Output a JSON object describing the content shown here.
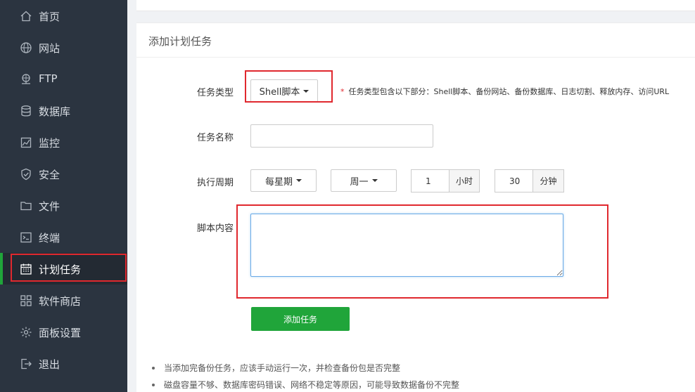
{
  "sidebar": {
    "items": [
      {
        "label": "首页",
        "icon": "home-icon"
      },
      {
        "label": "网站",
        "icon": "globe-icon"
      },
      {
        "label": "FTP",
        "icon": "ftp-icon"
      },
      {
        "label": "数据库",
        "icon": "database-icon"
      },
      {
        "label": "监控",
        "icon": "monitor-icon"
      },
      {
        "label": "安全",
        "icon": "shield-icon"
      },
      {
        "label": "文件",
        "icon": "folder-icon"
      },
      {
        "label": "终端",
        "icon": "terminal-icon"
      },
      {
        "label": "计划任务",
        "icon": "calendar-icon"
      },
      {
        "label": "软件商店",
        "icon": "apps-icon"
      },
      {
        "label": "面板设置",
        "icon": "gear-icon"
      },
      {
        "label": "退出",
        "icon": "logout-icon"
      }
    ],
    "active": "计划任务"
  },
  "form": {
    "title": "添加计划任务",
    "task_type_label": "任务类型",
    "task_type_value": "Shell脚本",
    "task_type_hint": "任务类型包含以下部分：Shell脚本、备份网站、备份数据库、日志切割、释放内存、访问URL",
    "task_name_label": "任务名称",
    "task_name_value": "",
    "cycle_label": "执行周期",
    "cycle_value": "每星期",
    "weekday_value": "周一",
    "hour_value": "1",
    "hour_unit": "小时",
    "minute_value": "30",
    "minute_unit": "分钟",
    "script_label": "脚本内容",
    "script_value": "",
    "submit_label": "添加任务"
  },
  "notes": [
    "当添加完备份任务，应该手动运行一次，并检查备份包是否完整",
    "磁盘容量不够、数据库密码错误、网络不稳定等原因，可能导致数据备份不完整"
  ],
  "colors": {
    "sidebar_bg": "#2b3440",
    "accent": "#20a53a",
    "highlight_box": "#e0282e"
  }
}
